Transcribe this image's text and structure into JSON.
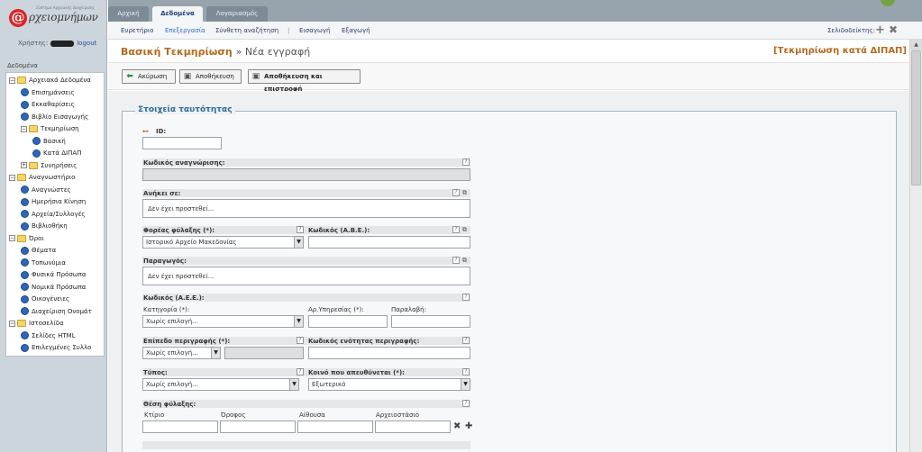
{
  "logo": {
    "at": "@",
    "name": "ρχειομνήμων",
    "tagline": "Σύστημα Αρχειακής Διαχείρισης"
  },
  "user": {
    "label": "Χρήστης:",
    "logout": "logout"
  },
  "tree": {
    "title": "Δεδομένα",
    "nodes": [
      {
        "label": "Αρχειακά Δεδομένα",
        "kind": "folder",
        "level": 0,
        "exp": "−"
      },
      {
        "label": "Επισημάνσεις",
        "kind": "doc",
        "level": 1
      },
      {
        "label": "Εκκαθαρίσεις",
        "kind": "doc",
        "level": 1
      },
      {
        "label": "Βιβλίο Εισαγωγής",
        "kind": "doc",
        "level": 1
      },
      {
        "label": "Τεκμηρίωση",
        "kind": "folder",
        "level": 1,
        "exp": "−"
      },
      {
        "label": "Βασική",
        "kind": "doc",
        "level": 2
      },
      {
        "label": "Κατά ΔΙΠΑΠ",
        "kind": "doc",
        "level": 2
      },
      {
        "label": "Συνηρήσεις",
        "kind": "folder",
        "level": 1,
        "exp": "+"
      },
      {
        "label": "Αναγνωστήριο",
        "kind": "folder",
        "level": 0,
        "exp": "−"
      },
      {
        "label": "Αναγνώστες",
        "kind": "doc",
        "level": 1
      },
      {
        "label": "Ημερήσια Κίνηση",
        "kind": "doc",
        "level": 1
      },
      {
        "label": "Αρχεία/Συλλογές",
        "kind": "doc",
        "level": 1
      },
      {
        "label": "Βιβλιοθήκη",
        "kind": "doc",
        "level": 1
      },
      {
        "label": "Όροι",
        "kind": "folder",
        "level": 0,
        "exp": "−"
      },
      {
        "label": "Θέματα",
        "kind": "doc",
        "level": 1
      },
      {
        "label": "Τοπωνύμια",
        "kind": "doc",
        "level": 1
      },
      {
        "label": "Φυσικά Πρόσωπα",
        "kind": "doc",
        "level": 1
      },
      {
        "label": "Νομικά Πρόσωπα",
        "kind": "doc",
        "level": 1
      },
      {
        "label": "Οικογένειες",
        "kind": "doc",
        "level": 1
      },
      {
        "label": "Διαχείριση Ονομάτ",
        "kind": "doc",
        "level": 1
      },
      {
        "label": "Ιστοσελίδα",
        "kind": "folder",
        "level": 0,
        "exp": "−"
      },
      {
        "label": "Σελίδες HTML",
        "kind": "doc",
        "level": 1
      },
      {
        "label": "Επιλεγμένες Συλλο",
        "kind": "doc",
        "level": 1
      }
    ]
  },
  "tabs": [
    {
      "label": "Αρχική",
      "active": false
    },
    {
      "label": "Δεδομένα",
      "active": true
    },
    {
      "label": "Λογαριασμός",
      "active": false
    }
  ],
  "menu": {
    "items": [
      {
        "label": "Ευρετήριο",
        "selected": false
      },
      {
        "label": "Επεξεργασία",
        "selected": true
      },
      {
        "label": "Σύνθετη αναζήτηση",
        "selected": false
      },
      {
        "label": "Εισαγωγή",
        "selected": false
      },
      {
        "label": "Εξαγωγή",
        "selected": false
      }
    ],
    "separator": "|",
    "bookmarks": "Σελιδοδείκτης:",
    "bookmark_add": "+",
    "bookmark_close": "✖"
  },
  "header": {
    "title": "Βασική Τεκμηρίωση",
    "subtitle": "» Νέα εγγραφή",
    "right_link": "[Τεκμηρίωση κατά ΔΙΠΑΠ]"
  },
  "toolbar": {
    "cancel": "Ακύρωση",
    "save": "Αποθήκευση",
    "save_return": "Αποθήκευση και επιστροφή"
  },
  "form": {
    "legend": "Στοιχεία ταυτότητας",
    "id_label": "ID:",
    "recognition_code_label": "Κωδικός αναγνώρισης:",
    "belongs_label": "Ανήκει σε:",
    "not_added": "Δεν έχει προστεθεί...",
    "custodian_label": "Φορέας φύλαξης (*):",
    "custodian_value": "Ιστορικό Αρχείο Μακεδονίας",
    "abe_label": "Κωδικός (Α.Β.Ε.):",
    "producer_label": "Παραγωγός:",
    "aee_label": "Κωδικός (Α.Ε.Ε.):",
    "category_label": "Κατηγορία (*):",
    "no_selection": "Χωρίς επιλογή...",
    "service_no_label": "Αρ.Υπηρεσίας (*):",
    "receipt_label": "Παραλαβή:",
    "level_label": "Επίπεδο περιγραφής (*):",
    "unit_code_label": "Κωδικός ενότητας περιγραφής:",
    "type_label": "Τύπος:",
    "audience_label": "Κοινό που απευθύνεται (*):",
    "audience_value": "Εξωτερικό",
    "storage_label": "Θέση φύλαξης:",
    "building_label": "Κτίριο",
    "floor_label": "Όροφος",
    "hall_label": "Αίθουσα",
    "cabinet_label": "Αρχειοστάσιο",
    "help": "?",
    "popup": "⧉",
    "remove": "✖",
    "add": "✚"
  }
}
